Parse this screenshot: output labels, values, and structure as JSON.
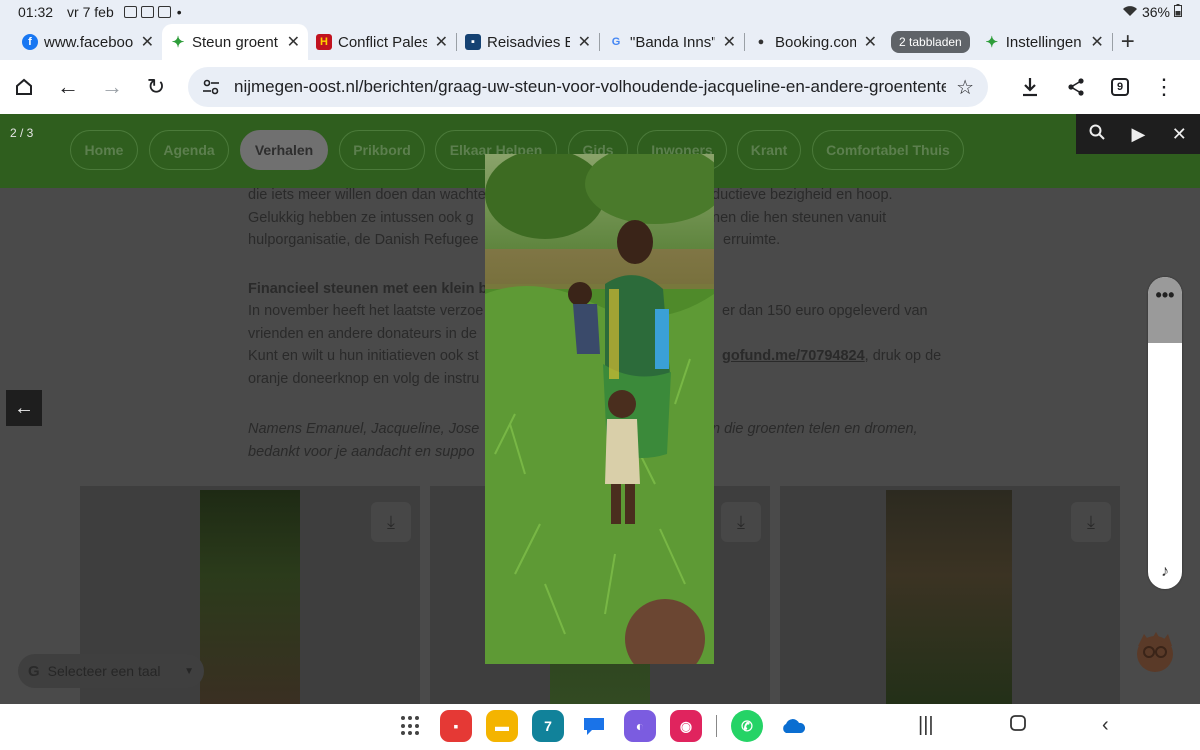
{
  "status_bar": {
    "time": "01:32",
    "date": "vr 7 feb",
    "dot": "•",
    "battery": "36%"
  },
  "tabs": [
    {
      "label": "www.faceboo",
      "favicon": "f",
      "favicon_color": "#1877f2"
    },
    {
      "label": "Steun groent",
      "favicon": "✦",
      "favicon_color": "#2e9d3a",
      "active": true
    },
    {
      "label": "Conflict Pales",
      "favicon": "H",
      "favicon_color": "#c1121f"
    },
    {
      "label": "Reisadvies Er",
      "favicon": "▪",
      "favicon_color": "#154273"
    },
    {
      "label": "\"Banda Inns\"",
      "favicon": "G",
      "favicon_color": "#4285f4"
    },
    {
      "label": "Booking.com",
      "favicon": "●",
      "favicon_color": "#333333"
    },
    {
      "label": "Instellingen v",
      "favicon": "✦",
      "favicon_color": "#2e9d3a"
    }
  ],
  "tab_group": "2 tabbladen",
  "browser": {
    "url": "nijmegen-oost.nl/berichten/graag-uw-steun-voor-volhoudende-jacqueline-en-andere-groententele",
    "tab_count": "9"
  },
  "site_nav": [
    {
      "label": "Home"
    },
    {
      "label": "Agenda"
    },
    {
      "label": "Verhalen",
      "active": true
    },
    {
      "label": "Prikbord"
    },
    {
      "label": "Elkaar Helpen"
    },
    {
      "label": "Gids"
    },
    {
      "label": "Inwoners"
    },
    {
      "label": "Krant"
    },
    {
      "label": "Comfortabel Thuis"
    }
  ],
  "article": {
    "p1_line1": "die iets meer willen doen dan wachten",
    "p1_line1_right": "ductieve bezigheid en hoop.",
    "p1_line2": "Gelukkig hebben ze intussen ook g",
    "p1_line2_right": "nen die hen steunen vanuit",
    "p1_line3": "hulporganisatie, de Danish Refugee",
    "p1_line3_right": "erruimte.",
    "heading": "Financieel steunen met een klein bi",
    "p2_line1": "In november heeft het laatste verzoe",
    "p2_line1_right": "er dan 150 euro opgeleverd van",
    "p2_line2": "vrienden en andere donateurs in de",
    "p2_line3": "Kunt en wilt u hun initiatieven ook st",
    "p2_link": "gofund.me/70794824",
    "p2_line3_right": ", druk op de",
    "p2_line4": "oranje doneerknop en volg de instru",
    "p3_line1": "Namens Emanuel, Jacqueline, Jose",
    "p3_line1_right": "n die groenten telen en dromen,",
    "p3_line2": "bedankt voor je aandacht en suppo"
  },
  "language_selector": {
    "g": "G",
    "label": "Selecteer een taal",
    "arrow": "▼"
  },
  "lightbox": {
    "counter": "2 / 3"
  },
  "volume": {
    "level": 0.79,
    "menu": "•••",
    "icon": "♪"
  },
  "dock": {
    "apps": [
      {
        "name": "slides",
        "color": "#e53935",
        "glyph": "▪"
      },
      {
        "name": "files",
        "color": "#f4b400",
        "glyph": "▬"
      },
      {
        "name": "calendar",
        "color": "#11829a",
        "glyph": "7"
      },
      {
        "name": "messages",
        "color": "#ffffff",
        "glyph": "💬"
      },
      {
        "name": "internet",
        "color": "#7b5ce0",
        "glyph": "◐"
      },
      {
        "name": "camera",
        "color": "#e0245e",
        "glyph": "◉"
      },
      {
        "name": "whatsapp",
        "color": "#25d366",
        "glyph": "✆"
      },
      {
        "name": "onedrive",
        "color": "#ffffff",
        "glyph": "☁"
      }
    ]
  }
}
